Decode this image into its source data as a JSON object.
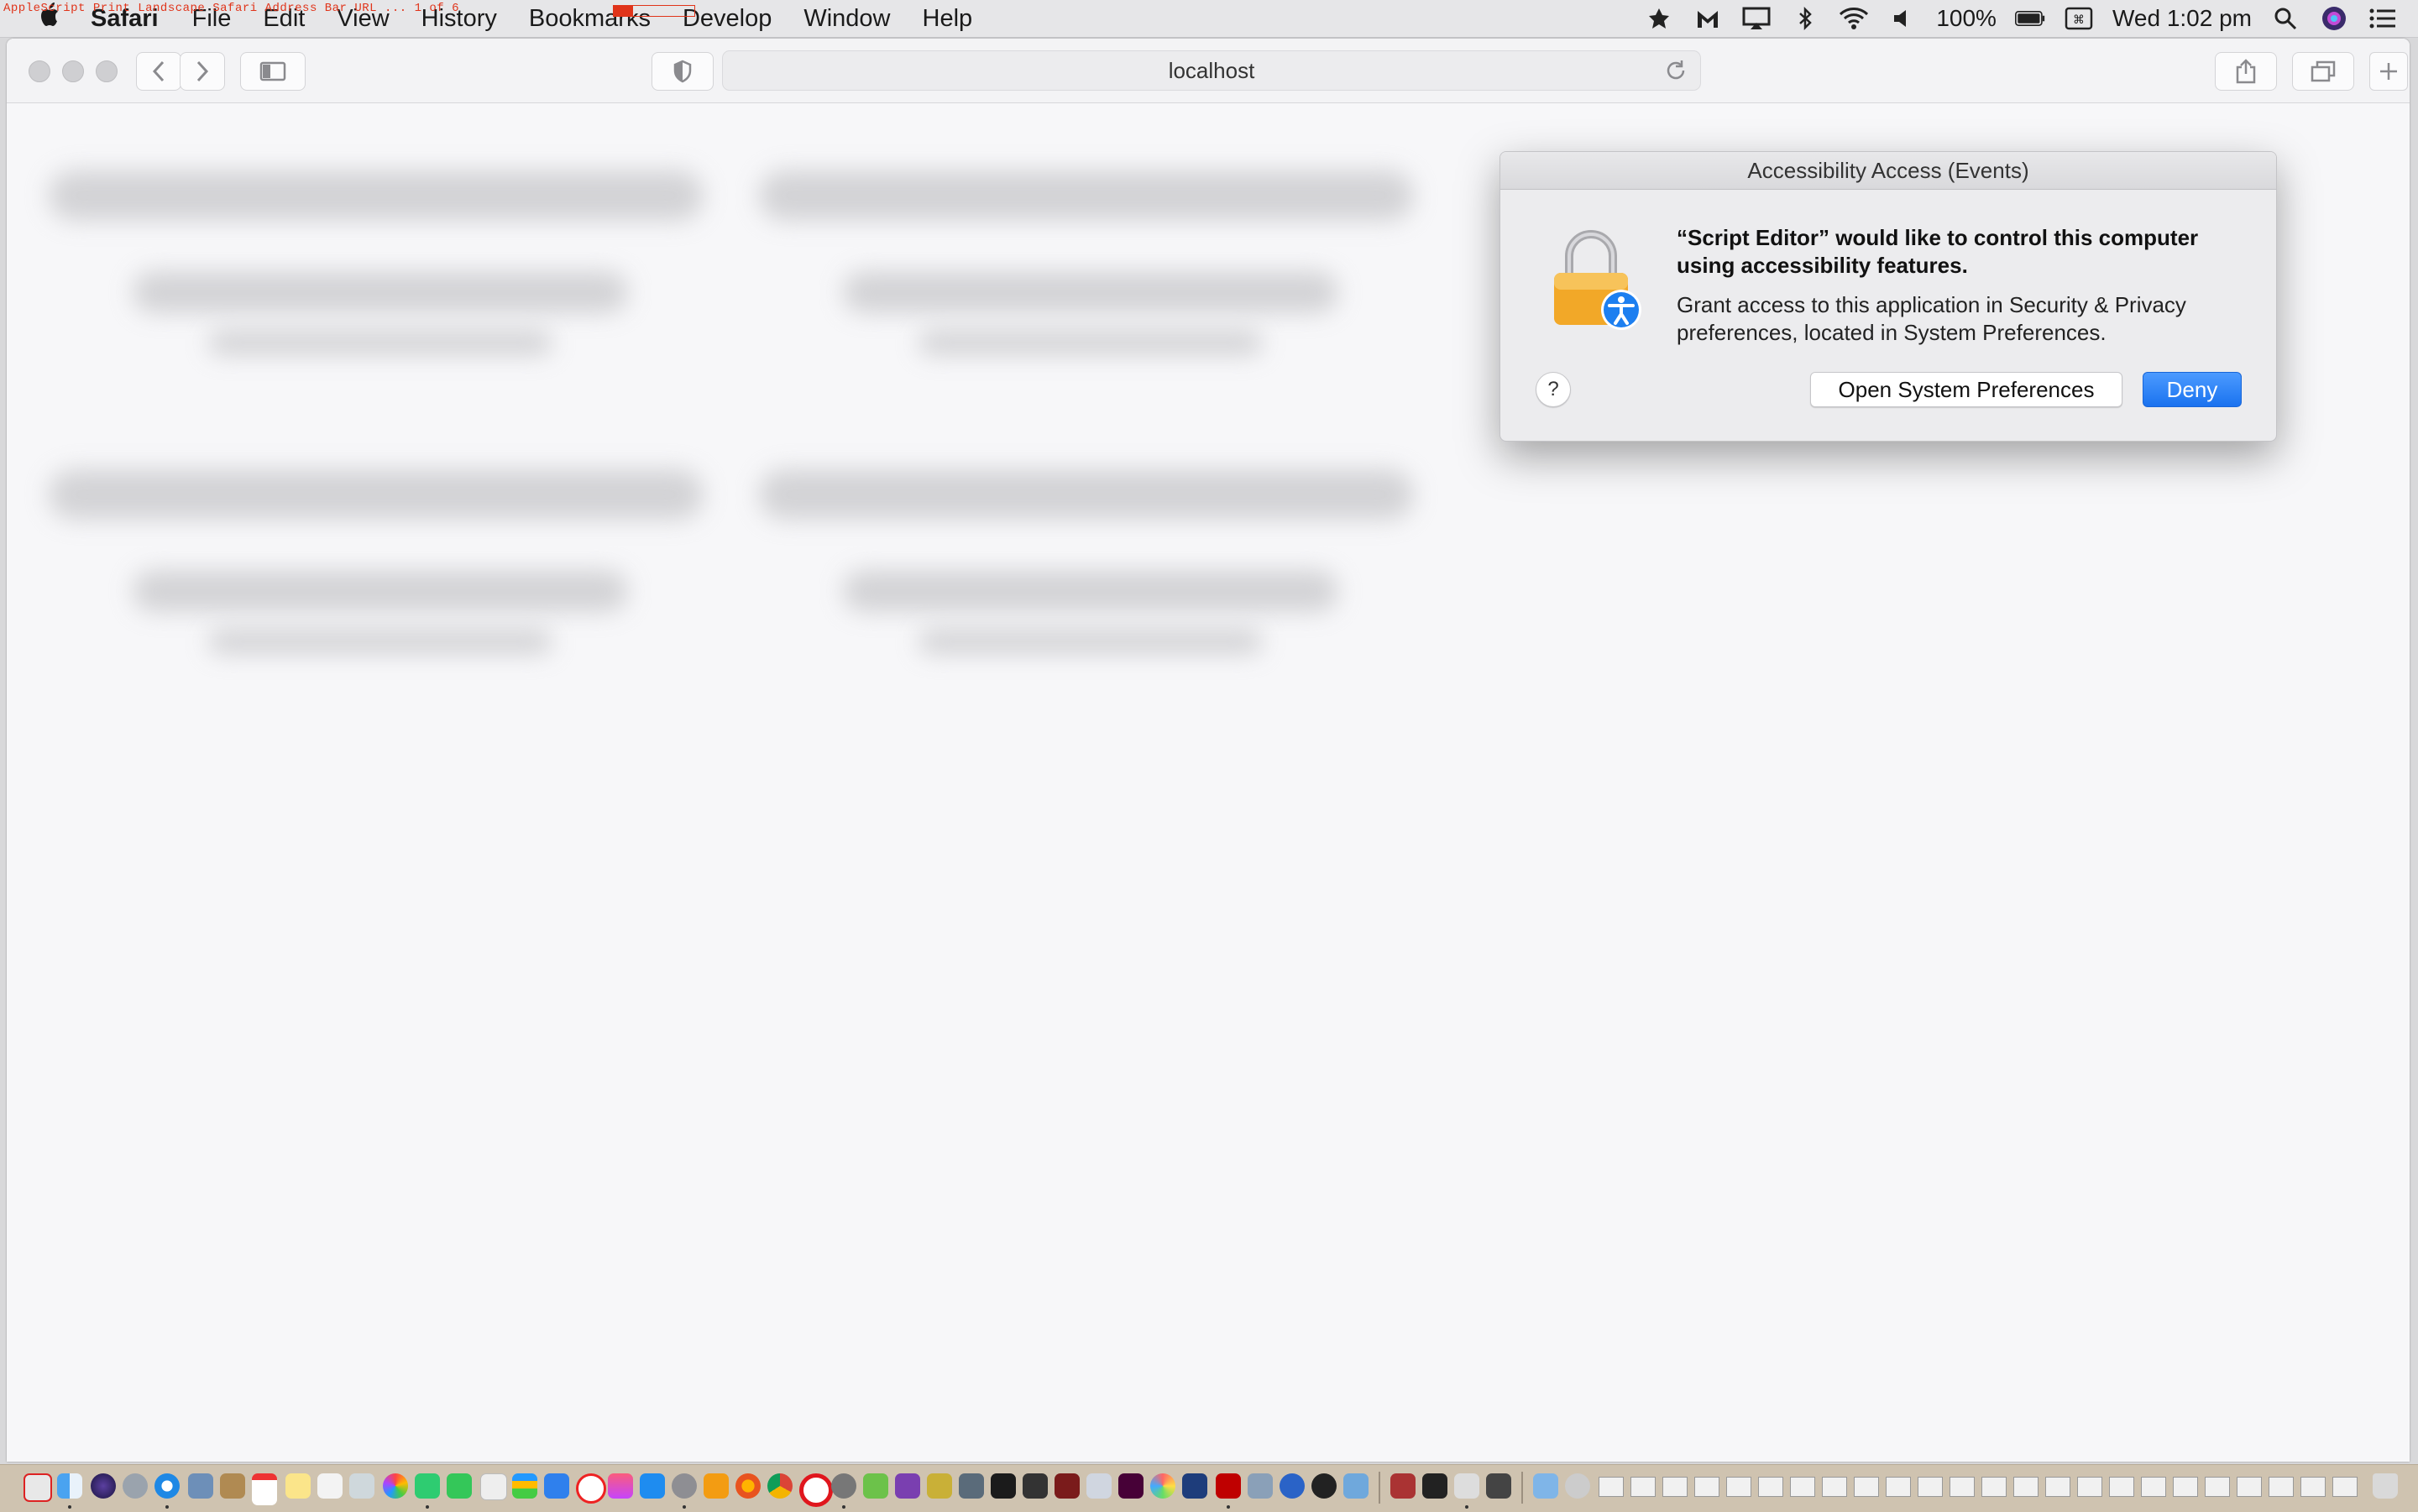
{
  "overlay": {
    "script_title": "AppleScript Print Landscape Safari Address Bar URL ... 1 of 6"
  },
  "menubar": {
    "app_name": "Safari",
    "items": [
      "File",
      "Edit",
      "View",
      "History",
      "Bookmarks",
      "Develop",
      "Window",
      "Help"
    ],
    "battery": "100%",
    "clock": "Wed 1:02 pm"
  },
  "browser": {
    "url": "localhost"
  },
  "dialog": {
    "title": "Accessibility Access (Events)",
    "heading": "“Script Editor” would like to control this computer using accessibility features.",
    "body": "Grant access to this application in Security & Privacy preferences, located in System Preferences.",
    "help_label": "?",
    "secondary_label": "Open System Preferences",
    "primary_label": "Deny"
  },
  "colors": {
    "accent": "#1a72ef",
    "dock": "#cfc3b0"
  }
}
